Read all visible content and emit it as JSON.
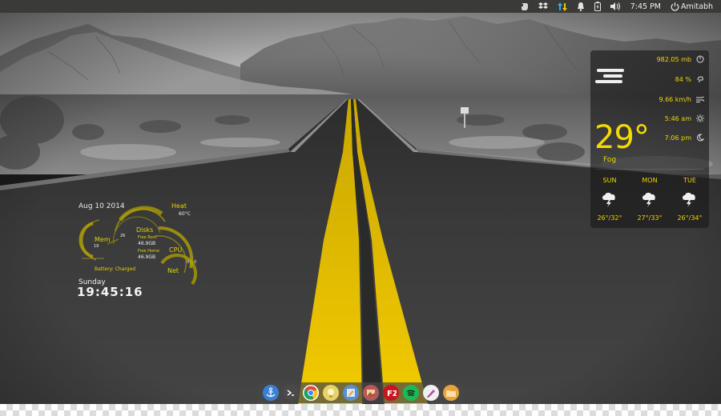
{
  "top_panel": {
    "time": "7:45 PM",
    "user": "Amitabh",
    "indicators": [
      "evernote-icon",
      "dropbox-icon",
      "network-updown-icon",
      "notification-bell-icon",
      "battery-icon",
      "volume-icon",
      "power-icon"
    ]
  },
  "weather": {
    "pressure": "982.05 mb",
    "humidity": "84 %",
    "wind": "9.66 km/h",
    "sunrise": "5:46 am",
    "sunset": "7:06 pm",
    "temperature": "29°",
    "condition": "Fog",
    "forecast": [
      {
        "day": "SUN",
        "temps": "26°/32°",
        "icon": "thunderstorm-icon"
      },
      {
        "day": "MON",
        "temps": "27°/33°",
        "icon": "thunderstorm-icon"
      },
      {
        "day": "TUE",
        "temps": "26°/34°",
        "icon": "thunderstorm-icon"
      }
    ],
    "colors": {
      "accent": "#f2d600"
    }
  },
  "conky": {
    "date": "Aug 10 2014",
    "heat_label": "Heat",
    "heat_value": "60°C",
    "mem_label": "Mem",
    "mem_value": "19",
    "mem_value2": "26",
    "disks_label": "Disks",
    "disk_root_label": "Free Root",
    "disk_root_value": "46.9GB",
    "disk_home_label": "Free Home",
    "disk_home_value": "46.9GB",
    "cpu_label": "CPU",
    "cpu_value": "0",
    "net_label": "Net",
    "net_value": "0",
    "battery": "Battery: Charged",
    "day": "Sunday",
    "clock": "19:45:16",
    "colors": {
      "ring": "#b8a800",
      "text": "#e6d200"
    }
  },
  "dock": {
    "items": [
      {
        "name": "anchor-icon",
        "color": "#3b7fd1"
      },
      {
        "name": "terminal-icon",
        "color": "#4a4a4a"
      },
      {
        "name": "chrome-icon",
        "color": "#dd4b39"
      },
      {
        "name": "lightbulb-icon",
        "color": "#f5c518"
      },
      {
        "name": "text-editor-icon",
        "color": "#5b8fd0"
      },
      {
        "name": "photos-icon",
        "color": "#b8575a"
      },
      {
        "name": "filezilla-icon",
        "color": "#c4161c"
      },
      {
        "name": "spotify-icon",
        "color": "#1db954"
      },
      {
        "name": "inkscape-icon",
        "color": "#f0f0f0"
      },
      {
        "name": "files-icon",
        "color": "#e8a33d"
      }
    ]
  }
}
